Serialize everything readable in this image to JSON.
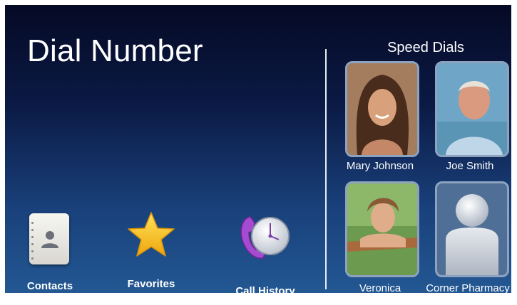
{
  "screen": {
    "title": "Dial Number"
  },
  "speed_dials": {
    "title": "Speed Dials",
    "contacts": [
      {
        "name": "Mary Johnson",
        "photo": "woman-portrait"
      },
      {
        "name": "Joe Smith",
        "photo": "older-man-portrait"
      },
      {
        "name": "Veronica",
        "photo": "young-woman-portrait"
      },
      {
        "name": "Corner Pharmacy",
        "photo": "generic-person-placeholder"
      }
    ]
  },
  "apps": [
    {
      "label": "Contacts",
      "icon": "address-book-icon"
    },
    {
      "label": "Favorites",
      "icon": "star-icon"
    },
    {
      "label": "Call History",
      "icon": "phone-clock-icon"
    }
  ],
  "colors": {
    "bg_top": "#050a25",
    "bg_bottom": "#235893",
    "tile_border": "#8da2bf",
    "star": "#f5c518"
  }
}
